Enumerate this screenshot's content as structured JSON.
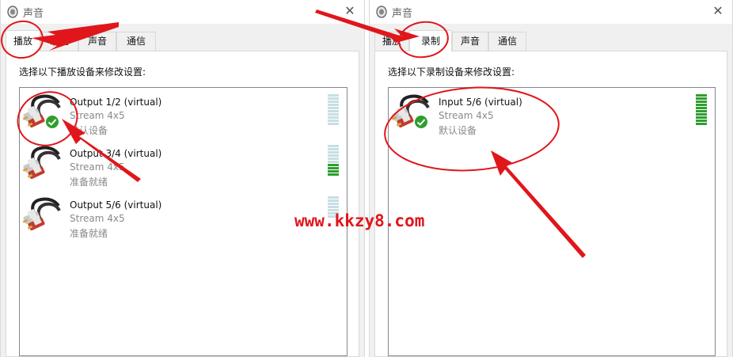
{
  "left_dialog": {
    "title": "声音",
    "tabs": [
      "播放",
      "录制",
      "声音",
      "通信"
    ],
    "instruction": "选择以下播放设备来修改设置:",
    "devices": [
      {
        "name": "Output 1/2 (virtual)",
        "subtitle": "Stream 4x5",
        "status": "默认设备",
        "is_default": true,
        "meter_level": 0.0
      },
      {
        "name": "Output 3/4 (virtual)",
        "subtitle": "Stream 4x5",
        "status": "准备就绪",
        "is_default": false,
        "meter_level": 0.4
      },
      {
        "name": "Output 5/6 (virtual)",
        "subtitle": "Stream 4x5",
        "status": "准备就绪",
        "is_default": false,
        "meter_level": 0.0
      }
    ]
  },
  "right_dialog": {
    "title": "声音",
    "tabs": [
      "播放",
      "录制",
      "声音",
      "通信"
    ],
    "instruction": "选择以下录制设备来修改设置:",
    "devices": [
      {
        "name": "Input 5/6 (virtual)",
        "subtitle": "Stream 4x5",
        "status": "默认设备",
        "is_default": true,
        "meter_level": 1.0
      }
    ]
  },
  "watermark": "www.kkzy8.com",
  "icons": [
    "speaker-icon",
    "close-icon",
    "rca-cable-icon",
    "default-check-icon"
  ],
  "colors": {
    "annotation_red": "#e0161b",
    "meter_on": "#2f9e2f",
    "meter_off": "#c7dfe4",
    "check_green": "#2f9e2f"
  }
}
